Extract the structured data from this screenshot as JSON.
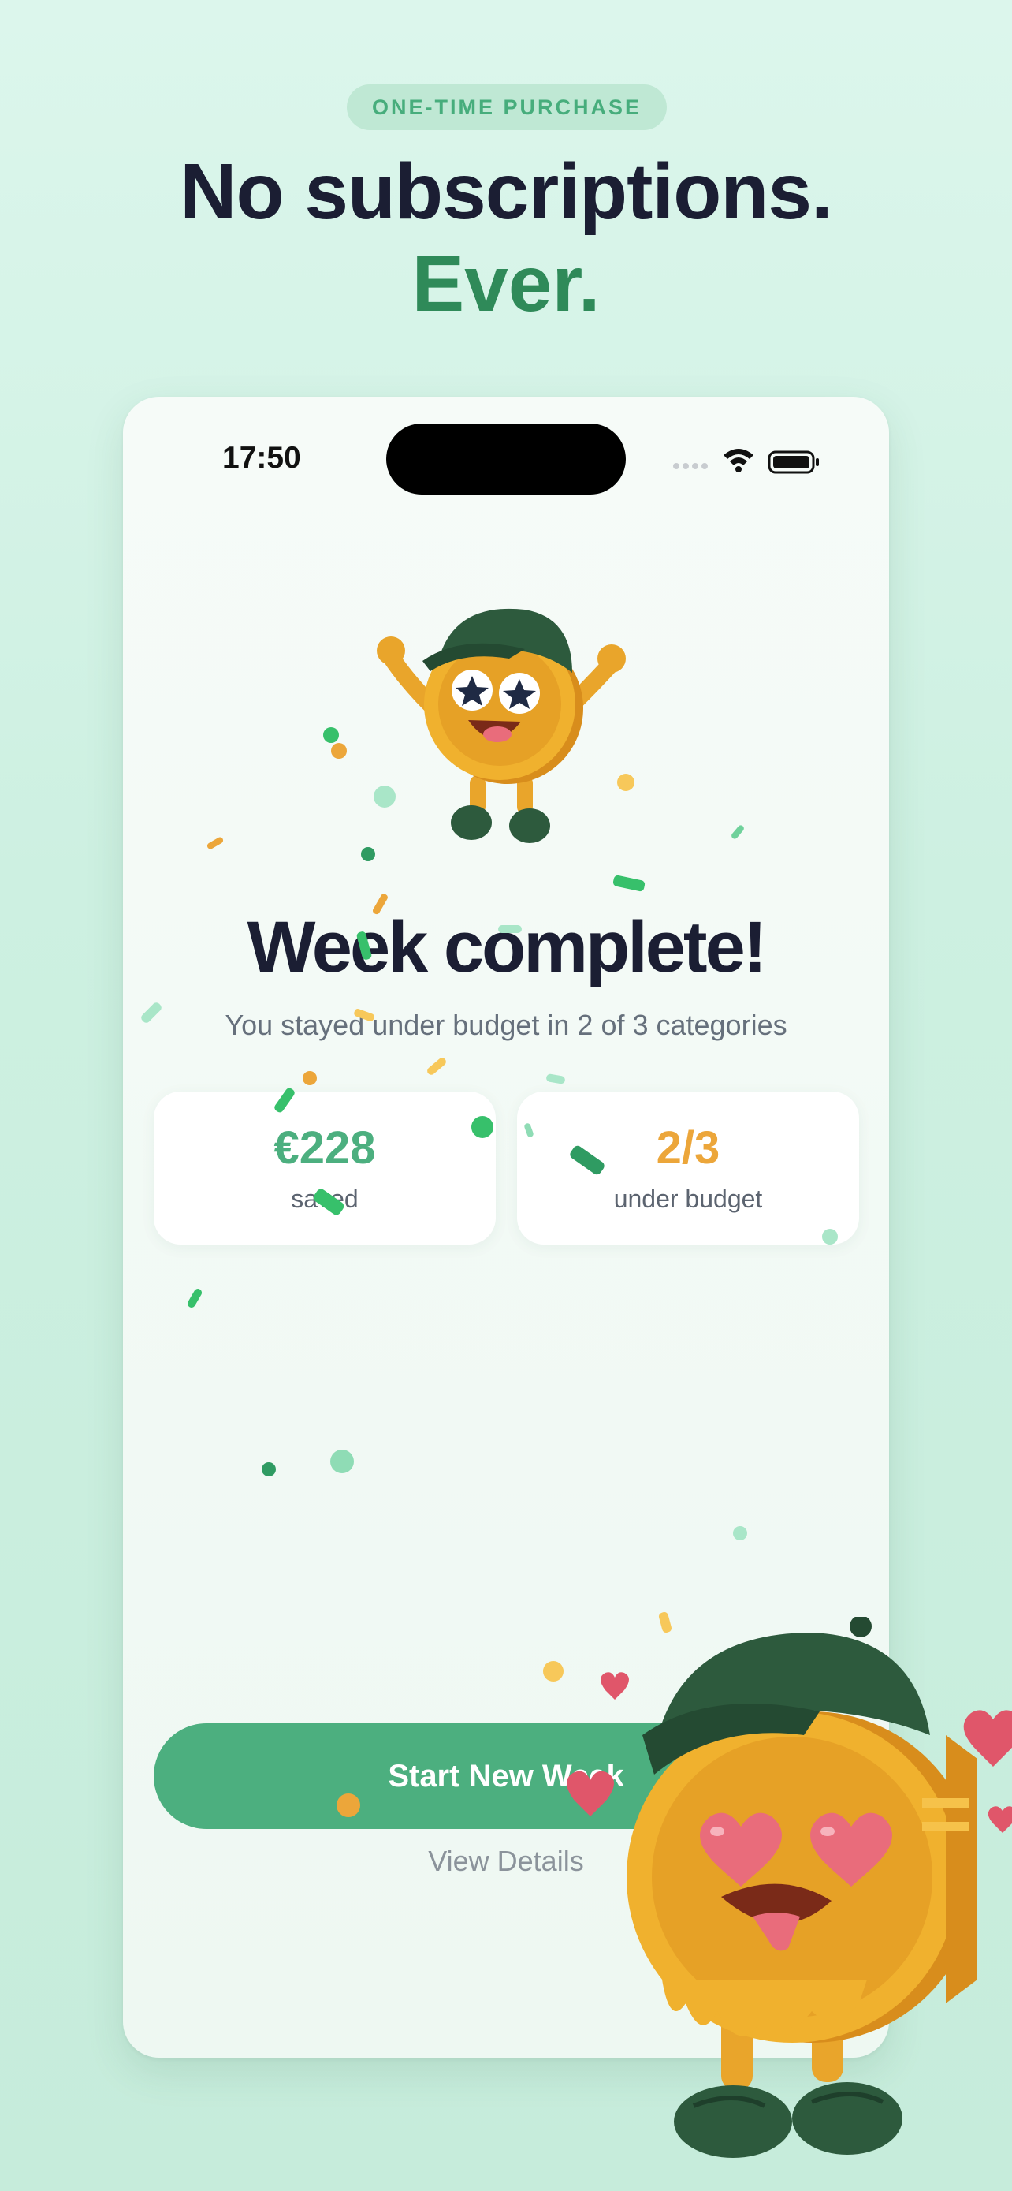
{
  "header": {
    "badge": "ONE-TIME PURCHASE",
    "headline_line1": "No subscriptions.",
    "headline_line2": "Ever."
  },
  "status_bar": {
    "time": "17:50",
    "icons": [
      "signal-icon",
      "wifi-icon",
      "battery-icon"
    ]
  },
  "screen": {
    "title": "Week complete!",
    "subtitle": "You stayed under budget in 2 of 3 categories",
    "stats": [
      {
        "value": "€228",
        "label": "saved"
      },
      {
        "value": "2/3",
        "label": "under budget"
      }
    ],
    "primary_button": "Start New Week",
    "secondary_link": "View Details"
  },
  "colors": {
    "brand_green": "#4caf7f",
    "dark_green": "#2f8a59",
    "accent_orange": "#eca63a",
    "text_dark": "#1b1e33"
  }
}
